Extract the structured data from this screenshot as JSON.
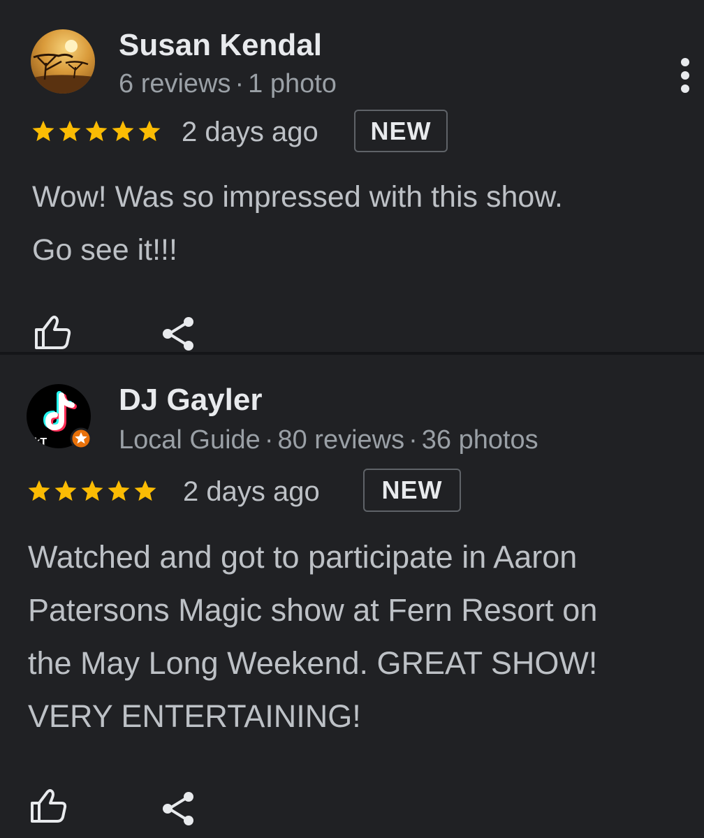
{
  "colors": {
    "background": "#202124",
    "star": "#fbbc04",
    "text_primary": "#e8eaed",
    "text_secondary": "#9aa0a6",
    "local_guide_badge": "#e8710a"
  },
  "reviews": [
    {
      "author": "Susan Kendal",
      "reviews_count": "6 reviews",
      "photos_count": "1 photo",
      "rating": 5,
      "time": "2 days ago",
      "badge": "NEW",
      "text_lines": [
        "Wow! Was so impressed with this show.",
        "Go see it!!!"
      ],
      "avatar_icon": "savanna-sunset-avatar",
      "actions": [
        "thumbs-up-icon",
        "share-icon"
      ],
      "menu_icon": "more-vert-icon"
    },
    {
      "author": "DJ Gayler",
      "guide_label": "Local Guide",
      "reviews_count": "80 reviews",
      "photos_count": "36 photos",
      "rating": 5,
      "time": "2 days ago",
      "badge": "NEW",
      "text_lines": [
        "Watched and got to participate in Aaron",
        "Patersons Magic show at Fern Resort on",
        "the May Long Weekend. GREAT SHOW!",
        "VERY ENTERTAINING!"
      ],
      "avatar_icon": "tiktok-logo-avatar",
      "avatar_caption": "ikT",
      "actions": [
        "thumbs-up-icon",
        "share-icon"
      ]
    }
  ]
}
